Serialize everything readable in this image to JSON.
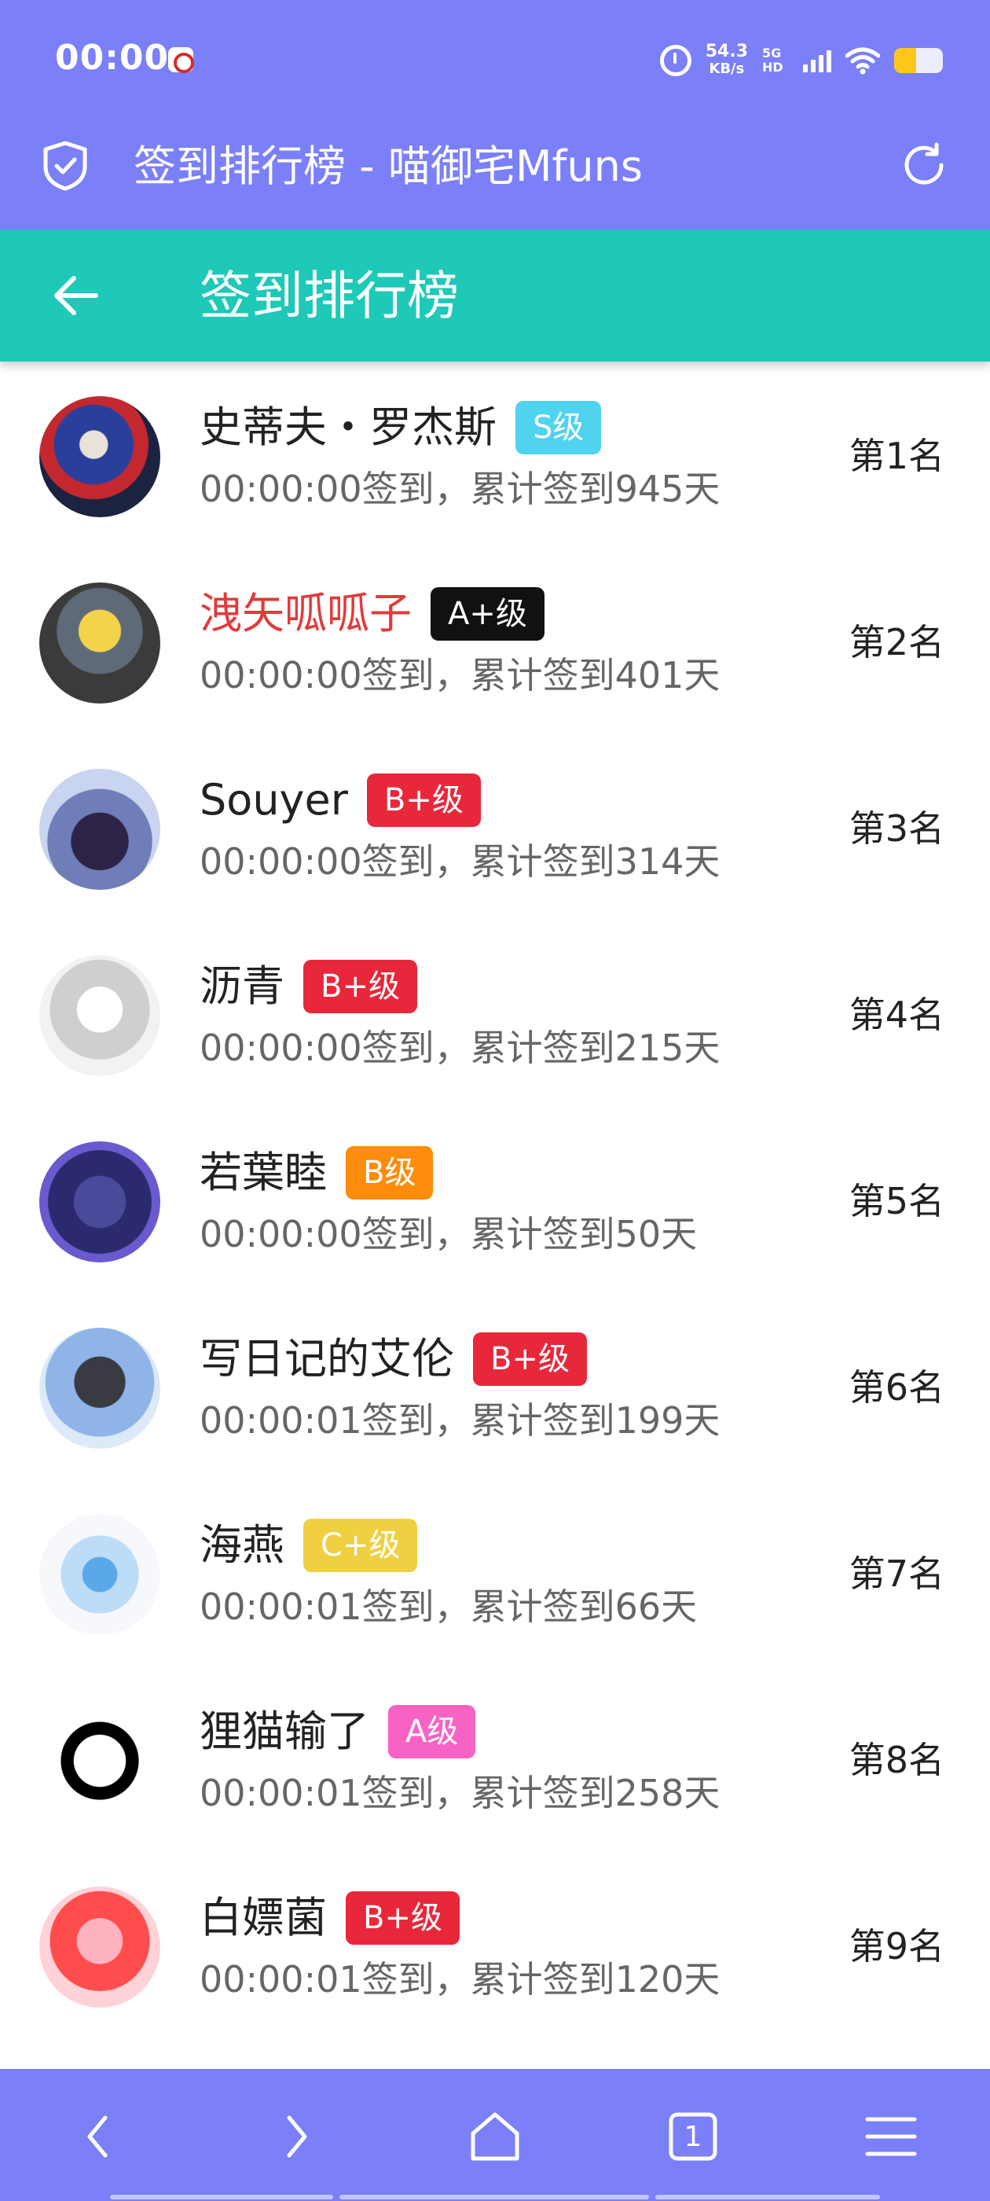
{
  "status_bar": {
    "time": "00:00",
    "net_speed_value": "54.3",
    "net_speed_unit": "KB/s",
    "net_type": "5G HD",
    "battery_level": 0.45,
    "battery_color": "#ffc61a"
  },
  "browser": {
    "page_title": "签到排行榜 - 喵御宅Mfuns",
    "security_icon": "shield-check-icon",
    "reload_icon": "reload-icon"
  },
  "header": {
    "title": "签到排行榜",
    "back_icon": "arrow-left-icon"
  },
  "colors": {
    "bar_purple": "#7b7ff8",
    "header_teal": "#1ec9b8",
    "badge_s": "#4fd3ee",
    "badge_a_plus": "#111111",
    "badge_b_plus": "#e8283a",
    "badge_b": "#ff8c0a",
    "badge_c_plus": "#f0d040",
    "badge_a": "#f763c4"
  },
  "ranking": [
    {
      "name": "史蒂夫・罗杰斯",
      "badge": "S级",
      "badge_color": "#4fd3ee",
      "checkin": "00:00:00签到，累计签到945天",
      "rank": "第1名",
      "highlight": false
    },
    {
      "name": "洩矢呱呱子",
      "badge": "A+级",
      "badge_color": "#111111",
      "checkin": "00:00:00签到，累计签到401天",
      "rank": "第2名",
      "highlight": true
    },
    {
      "name": "Souyer",
      "badge": "B+级",
      "badge_color": "#e8283a",
      "checkin": "00:00:00签到，累计签到314天",
      "rank": "第3名",
      "highlight": false
    },
    {
      "name": "沥青",
      "badge": "B+级",
      "badge_color": "#e8283a",
      "checkin": "00:00:00签到，累计签到215天",
      "rank": "第4名",
      "highlight": false
    },
    {
      "name": "若葉睦",
      "badge": "B级",
      "badge_color": "#ff8c0a",
      "checkin": "00:00:00签到，累计签到50天",
      "rank": "第5名",
      "highlight": false
    },
    {
      "name": "写日记的艾伦",
      "badge": "B+级",
      "badge_color": "#e8283a",
      "checkin": "00:00:01签到，累计签到199天",
      "rank": "第6名",
      "highlight": false
    },
    {
      "name": "海燕",
      "badge": "C+级",
      "badge_color": "#f0d040",
      "checkin": "00:00:01签到，累计签到66天",
      "rank": "第7名",
      "highlight": false
    },
    {
      "name": "狸猫输了",
      "badge": "A级",
      "badge_color": "#f763c4",
      "checkin": "00:00:01签到，累计签到258天",
      "rank": "第8名",
      "highlight": false
    },
    {
      "name": "白嫖菌",
      "badge": "B+级",
      "badge_color": "#e8283a",
      "checkin": "00:00:01签到，累计签到120天",
      "rank": "第9名",
      "highlight": false
    }
  ],
  "bottom_nav": {
    "tab_count": "1",
    "items": [
      "back-icon",
      "forward-icon",
      "home-icon",
      "tabs-icon",
      "menu-icon"
    ]
  }
}
